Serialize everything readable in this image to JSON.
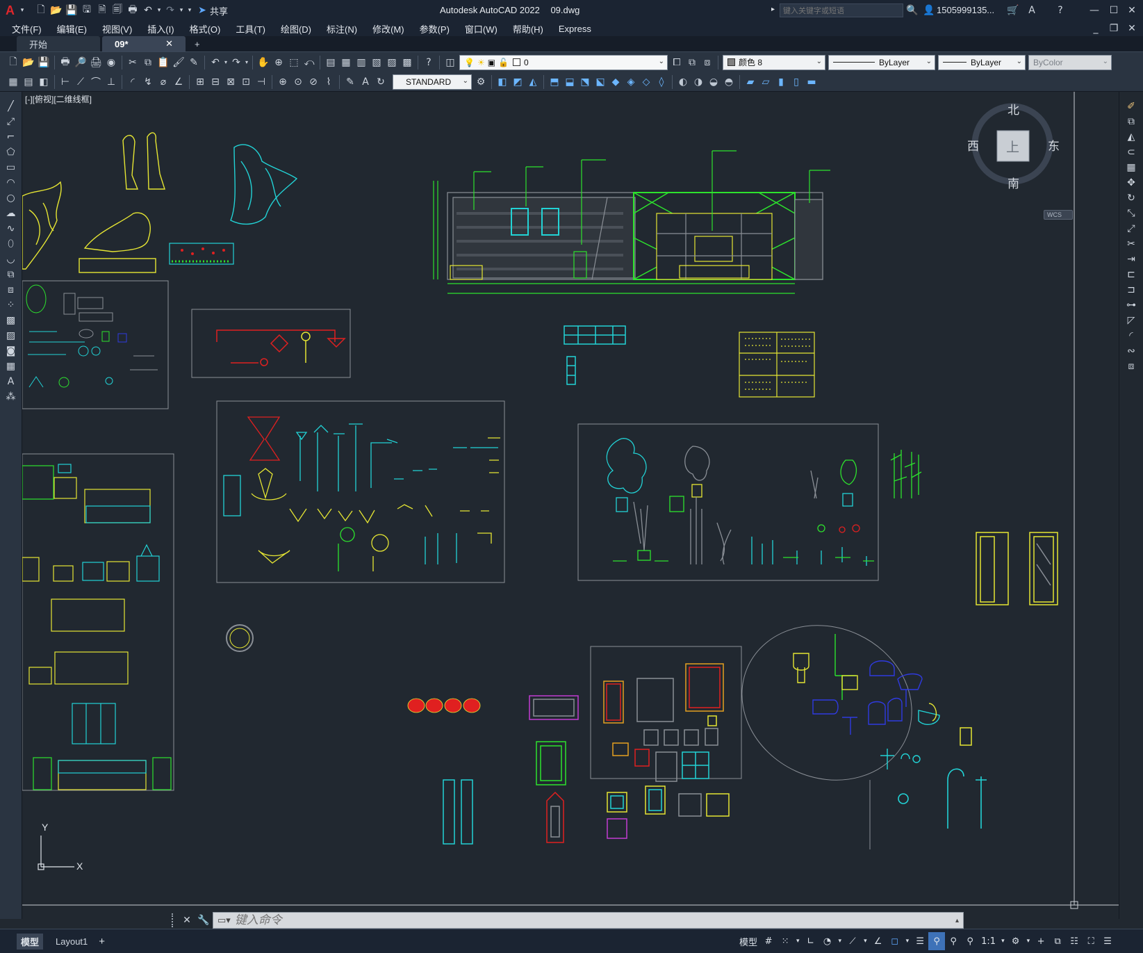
{
  "app": {
    "logo": "A",
    "title": "Autodesk AutoCAD 2022",
    "filename": "09.dwg",
    "share_label": "共享"
  },
  "search": {
    "placeholder": "键入关键字或短语"
  },
  "user": {
    "name": "1505999135..."
  },
  "menu": [
    "文件(F)",
    "编辑(E)",
    "视图(V)",
    "插入(I)",
    "格式(O)",
    "工具(T)",
    "绘图(D)",
    "标注(N)",
    "修改(M)",
    "参数(P)",
    "窗口(W)",
    "帮助(H)",
    "Express"
  ],
  "tabs": [
    {
      "label": "开始"
    },
    {
      "label": "09*"
    }
  ],
  "toolbar": {
    "layer_value": "0",
    "color_value": "颜色 8",
    "linetype_value": "ByLayer",
    "lineweight_value": "ByLayer",
    "plotstyle_value": "ByColor",
    "textstyle_value": "STANDARD"
  },
  "viewport": {
    "label": "[-][俯视][二维线框]"
  },
  "viewcube": {
    "north": "北",
    "south": "南",
    "east": "东",
    "west": "西",
    "top": "上",
    "wcs": "WCS"
  },
  "ucs": {
    "x": "X",
    "y": "Y"
  },
  "command": {
    "placeholder": "键入命令"
  },
  "layout_tabs": [
    {
      "label": "模型"
    },
    {
      "label": "Layout1"
    }
  ],
  "status": {
    "model_label": "模型",
    "scale": "1:1"
  },
  "colors": {
    "background": "#212830",
    "yellow": "#e6e633",
    "cyan": "#22d3d6",
    "green": "#2de32d",
    "red": "#e02020",
    "blue": "#2f3ae0",
    "gray": "#8a8f96"
  }
}
